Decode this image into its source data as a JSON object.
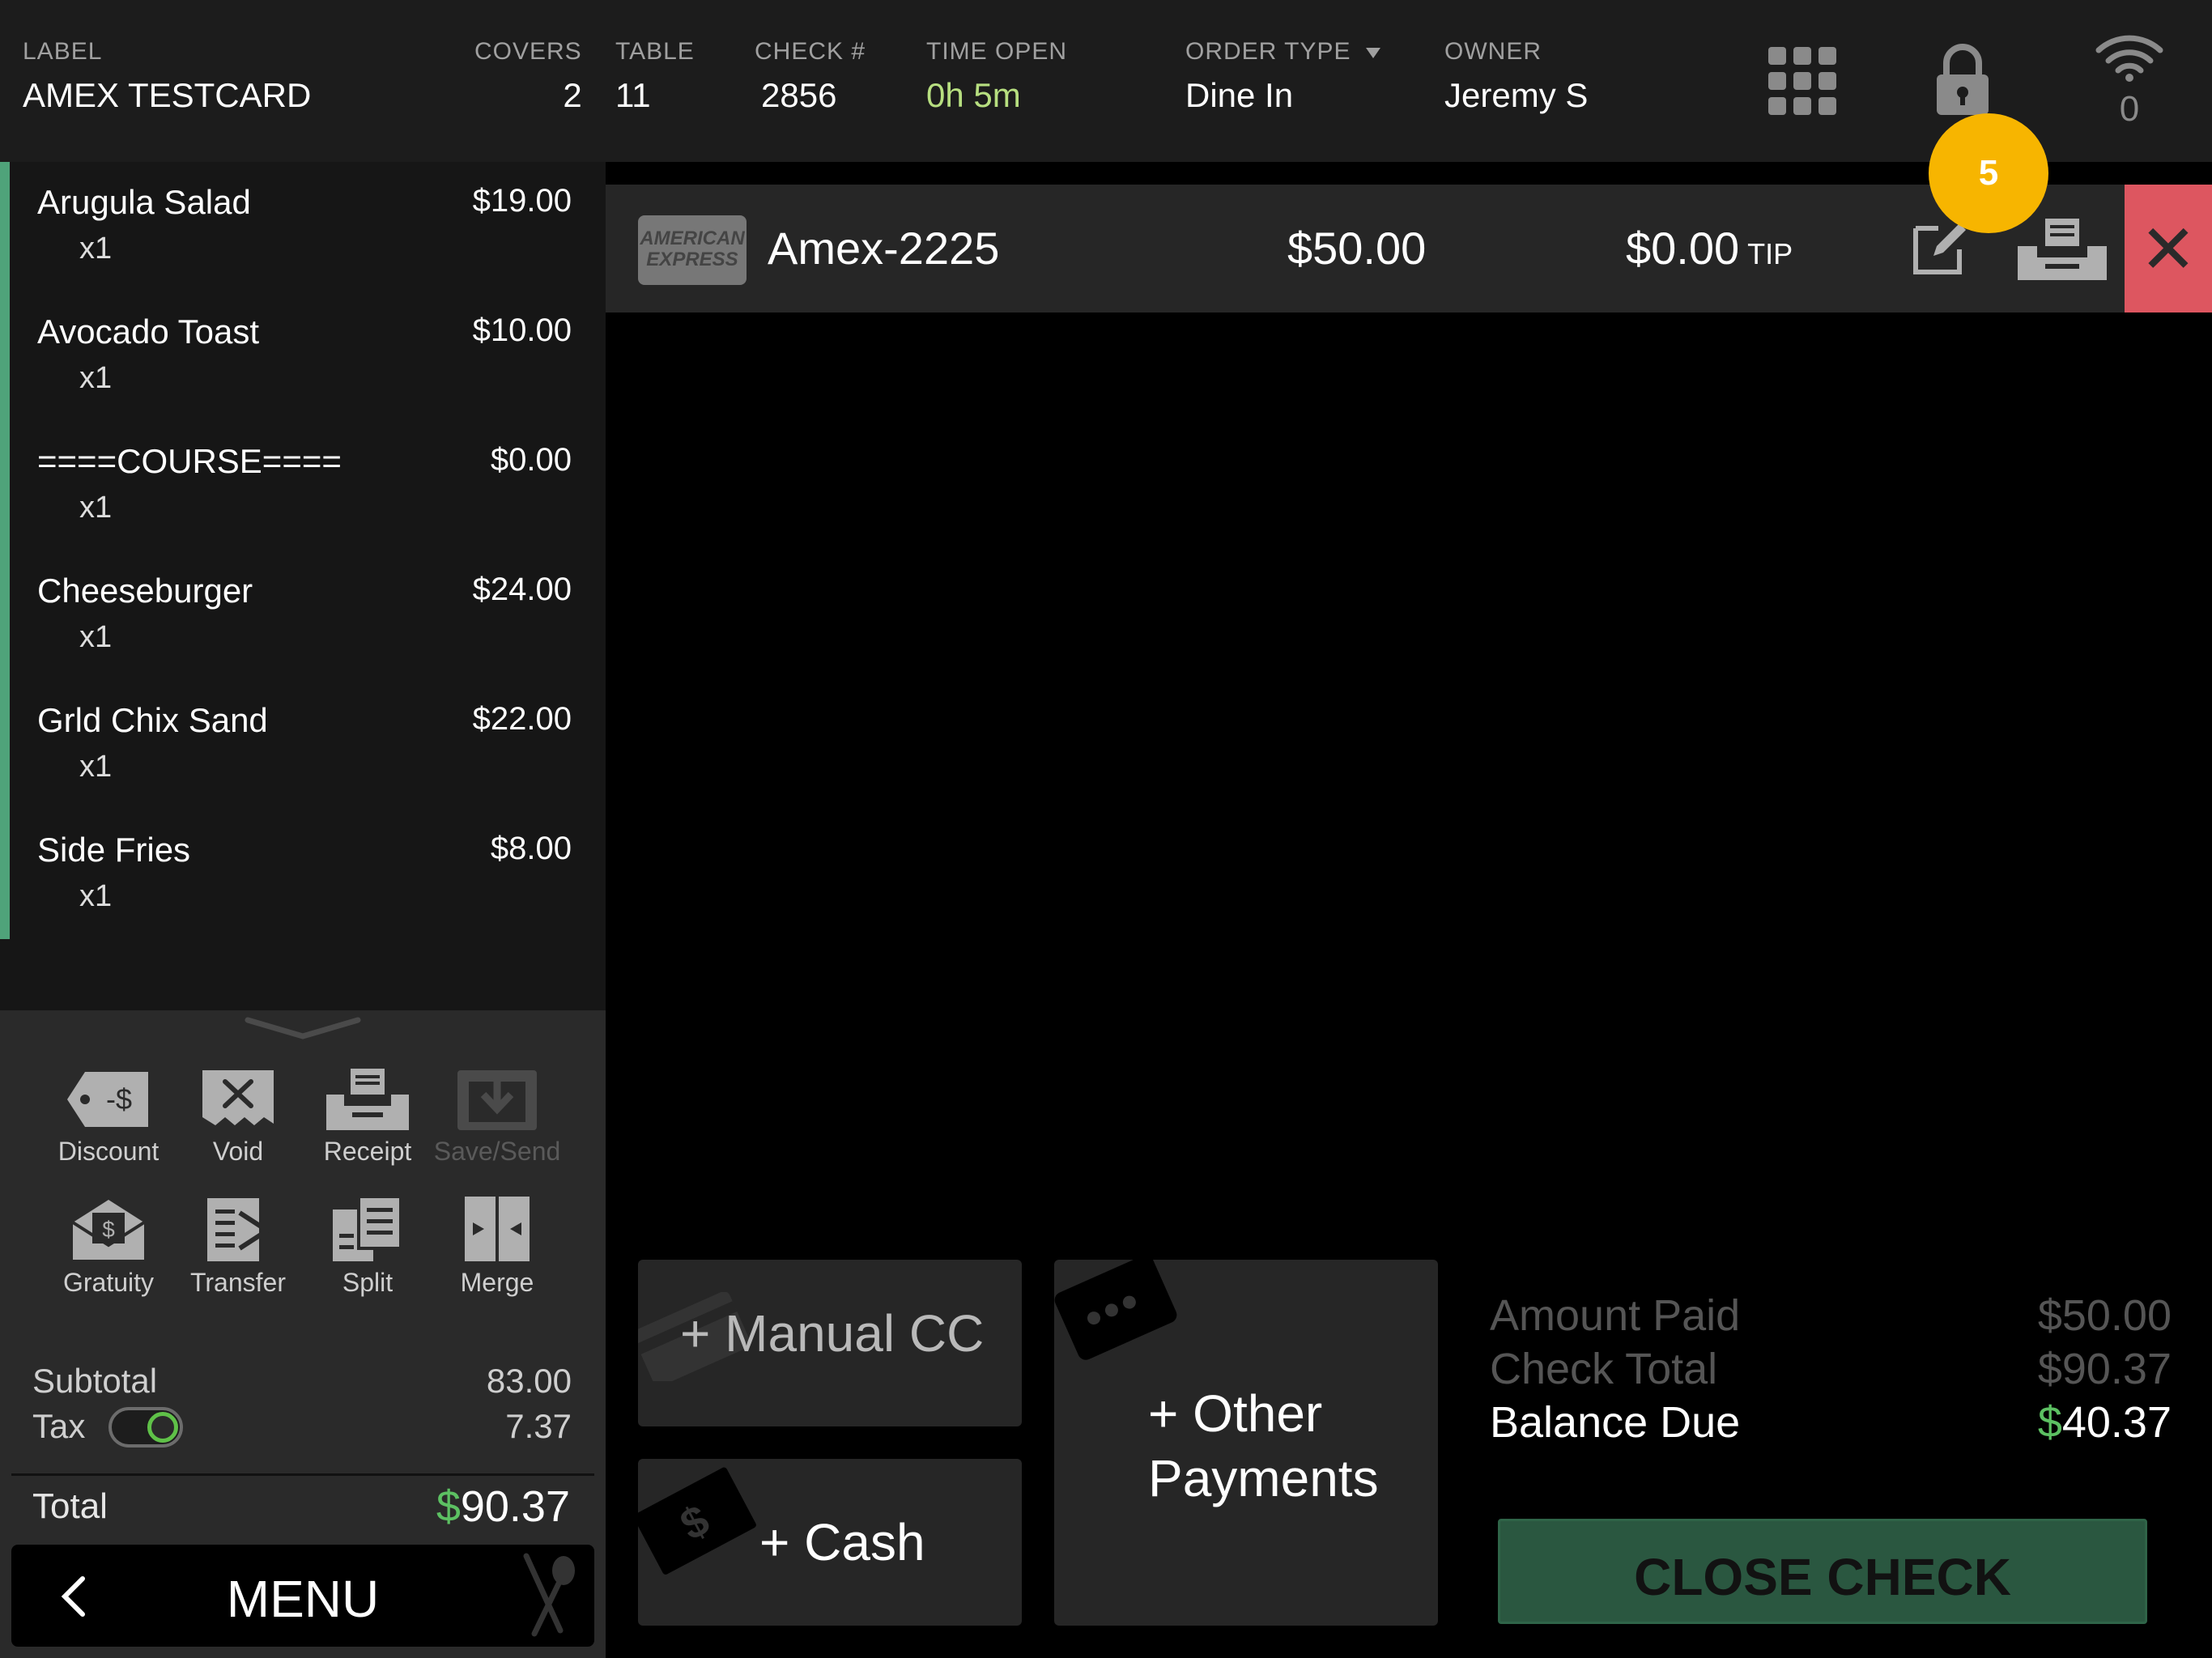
{
  "header": {
    "label": {
      "title": "LABEL",
      "value": "AMEX TESTCARD"
    },
    "covers": {
      "title": "COVERS",
      "value": "2"
    },
    "table": {
      "title": "TABLE",
      "value": "11"
    },
    "check": {
      "title": "CHECK #",
      "value": "2856"
    },
    "time_open": {
      "title": "TIME OPEN",
      "hours": "0h",
      "minutes": "5m"
    },
    "order_type": {
      "title": "ORDER TYPE",
      "value": "Dine In"
    },
    "owner": {
      "title": "OWNER",
      "value": "Jeremy S"
    },
    "icons": {
      "grid": "grid-icon",
      "lock": "lock-icon",
      "wifi": "wifi-icon"
    },
    "wifi_count": "0"
  },
  "order_items": [
    {
      "name": "Arugula Salad",
      "price": "$19.00",
      "qty": "x1"
    },
    {
      "name": "Avocado Toast",
      "price": "$10.00",
      "qty": "x1"
    },
    {
      "name": "====COURSE====",
      "price": "$0.00",
      "qty": "x1"
    },
    {
      "name": "Cheeseburger",
      "price": "$24.00",
      "qty": "x1"
    },
    {
      "name": "Grld Chix Sand",
      "price": "$22.00",
      "qty": "x1"
    },
    {
      "name": "Side Fries",
      "price": "$8.00",
      "qty": "x1"
    }
  ],
  "actions": [
    {
      "label": "Discount",
      "icon": "discount-tag-icon",
      "enabled": true
    },
    {
      "label": "Void",
      "icon": "void-receipt-icon",
      "enabled": true
    },
    {
      "label": "Receipt",
      "icon": "printer-icon",
      "enabled": true
    },
    {
      "label": "Save/Send",
      "icon": "save-send-icon",
      "enabled": false
    },
    {
      "label": "Gratuity",
      "icon": "gratuity-envelope-icon",
      "enabled": true
    },
    {
      "label": "Transfer",
      "icon": "transfer-icon",
      "enabled": true
    },
    {
      "label": "Split",
      "icon": "split-icon",
      "enabled": true
    },
    {
      "label": "Merge",
      "icon": "merge-icon",
      "enabled": true
    }
  ],
  "totals": {
    "subtotal_label": "Subtotal",
    "subtotal": "83.00",
    "tax_label": "Tax",
    "tax": "7.37",
    "tax_enabled": true,
    "total_label": "Total",
    "total_currency": "$",
    "total": "90.37"
  },
  "menu_button": {
    "label": "MENU"
  },
  "payment": {
    "card_logo_line1": "AMERICAN",
    "card_logo_line2": "EXPRESS",
    "name": "Amex-2225",
    "amount": "$50.00",
    "tip": "$0.00",
    "tip_label": "TIP",
    "badge": "5"
  },
  "tender_buttons": {
    "manual_cc": "+ Manual CC",
    "cash": "+ Cash",
    "other_line1": "+ Other",
    "other_line2": "Payments"
  },
  "summary": {
    "amount_paid_label": "Amount Paid",
    "amount_paid": "$50.00",
    "check_total_label": "Check Total",
    "check_total": "$90.37",
    "balance_due_label": "Balance Due",
    "balance_currency": "$",
    "balance_due": "40.37"
  },
  "close_check": "CLOSE CHECK",
  "colors": {
    "accent_green": "#4fa37a",
    "money_green": "#5cc062",
    "badge_yellow": "#f7b500",
    "remove_red": "#dd5660",
    "close_button": "#2a5740"
  }
}
